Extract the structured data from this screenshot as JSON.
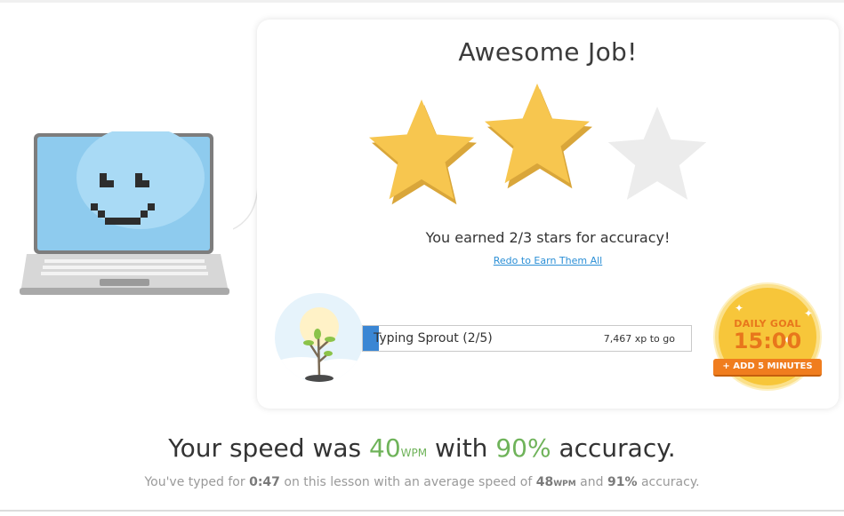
{
  "result": {
    "title": "Awesome Job!",
    "stars_earned": 2,
    "stars_total": 3,
    "earned_text": "You earned 2/3 stars for accuracy!",
    "redo_link": "Redo to Earn Them All"
  },
  "progress": {
    "level_label": "Typing Sprout (2/5)",
    "xp_to_go": "7,467 xp to go",
    "fill_fraction": 0.05
  },
  "daily_goal": {
    "label": "DAILY GOAL",
    "time": "15:00",
    "add_button": "+ ADD 5 MINUTES"
  },
  "summary": {
    "speed_prefix": "Your speed was",
    "speed_value": "40",
    "speed_unit": "WPM",
    "speed_mid": "with",
    "accuracy_value": "90%",
    "speed_suffix": "accuracy.",
    "sub_prefix": "You've typed for",
    "sub_time": "0:47",
    "sub_mid": "on this lesson with an average speed of",
    "sub_avg_speed": "48",
    "sub_avg_unit": "WPM",
    "sub_and": "and",
    "sub_avg_accuracy": "91%",
    "sub_suffix": "accuracy."
  },
  "colors": {
    "star_gold": "#f7c64f",
    "star_empty": "#ececec",
    "accent_green": "#6fb35a",
    "link_blue": "#2b8fd6",
    "progress_blue": "#3a86d4",
    "goal_orange": "#e8761c"
  }
}
